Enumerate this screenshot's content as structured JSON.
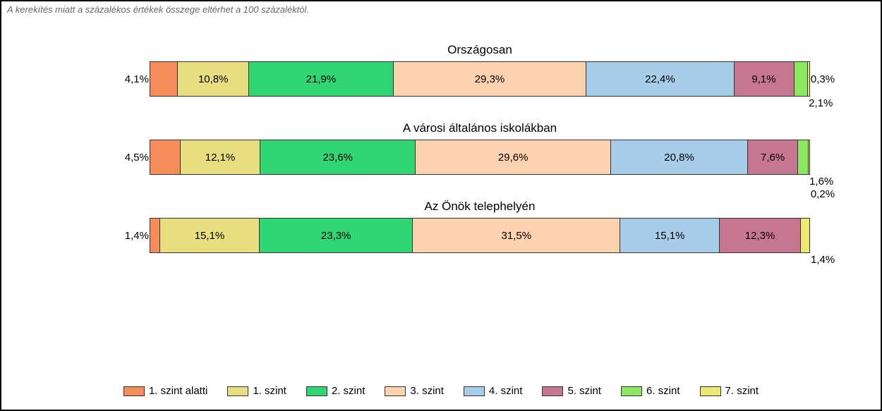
{
  "note": "A kerekítés miatt a százalékos értékek összege eltérhet a 100 százaléktól.",
  "legend": [
    {
      "label": "1. szint alatti",
      "cls": "c0"
    },
    {
      "label": "1. szint",
      "cls": "c1"
    },
    {
      "label": "2. szint",
      "cls": "c2"
    },
    {
      "label": "3. szint",
      "cls": "c3"
    },
    {
      "label": "4. szint",
      "cls": "c4"
    },
    {
      "label": "5. szint",
      "cls": "c5"
    },
    {
      "label": "6. szint",
      "cls": "c6"
    },
    {
      "label": "7. szint",
      "cls": "c7"
    }
  ],
  "chart_data": {
    "type": "bar",
    "stacked": true,
    "orientation": "horizontal",
    "unit": "percent",
    "categories": [
      "Országosan",
      "A városi általános iskolákban",
      "Az Önök telephelyén"
    ],
    "series_labels": [
      "1. szint alatti",
      "1. szint",
      "2. szint",
      "3. szint",
      "4. szint",
      "5. szint",
      "6. szint",
      "7. szint"
    ],
    "bars": [
      {
        "title": "Országosan",
        "segments": [
          {
            "label": "4,1%",
            "value": 4.1,
            "cls": "c0",
            "pos": "left"
          },
          {
            "label": "10,8%",
            "value": 10.8,
            "cls": "c1",
            "pos": "in"
          },
          {
            "label": "21,9%",
            "value": 21.9,
            "cls": "c2",
            "pos": "in"
          },
          {
            "label": "29,3%",
            "value": 29.3,
            "cls": "c3",
            "pos": "in"
          },
          {
            "label": "22,4%",
            "value": 22.4,
            "cls": "c4",
            "pos": "in"
          },
          {
            "label": "9,1%",
            "value": 9.1,
            "cls": "c5",
            "pos": "in"
          },
          {
            "label": "2,1%",
            "value": 2.1,
            "cls": "c6",
            "pos": "below"
          },
          {
            "label": "0,3%",
            "value": 0.3,
            "cls": "c7",
            "pos": "right"
          }
        ]
      },
      {
        "title": "A városi általános iskolákban",
        "segments": [
          {
            "label": "4,5%",
            "value": 4.5,
            "cls": "c0",
            "pos": "left"
          },
          {
            "label": "12,1%",
            "value": 12.1,
            "cls": "c1",
            "pos": "in"
          },
          {
            "label": "23,6%",
            "value": 23.6,
            "cls": "c2",
            "pos": "in"
          },
          {
            "label": "29,6%",
            "value": 29.6,
            "cls": "c3",
            "pos": "in"
          },
          {
            "label": "20,8%",
            "value": 20.8,
            "cls": "c4",
            "pos": "in"
          },
          {
            "label": "7,6%",
            "value": 7.6,
            "cls": "c5",
            "pos": "in"
          },
          {
            "label": "1,6%",
            "value": 1.6,
            "cls": "c6",
            "pos": "below"
          },
          {
            "label": "0,2%",
            "value": 0.2,
            "cls": "c7",
            "pos": "below2"
          }
        ]
      },
      {
        "title": "Az Önök telephelyén",
        "segments": [
          {
            "label": "1,4%",
            "value": 1.4,
            "cls": "c0",
            "pos": "left"
          },
          {
            "label": "15,1%",
            "value": 15.1,
            "cls": "c1",
            "pos": "in"
          },
          {
            "label": "23,3%",
            "value": 23.3,
            "cls": "c2",
            "pos": "in"
          },
          {
            "label": "31,5%",
            "value": 31.5,
            "cls": "c3",
            "pos": "in"
          },
          {
            "label": "15,1%",
            "value": 15.1,
            "cls": "c4",
            "pos": "in"
          },
          {
            "label": "12,3%",
            "value": 12.3,
            "cls": "c5",
            "pos": "in"
          },
          {
            "label": "",
            "value": 0,
            "cls": "c6",
            "pos": "none"
          },
          {
            "label": "1,4%",
            "value": 1.4,
            "cls": "c7",
            "pos": "below"
          }
        ]
      }
    ]
  }
}
